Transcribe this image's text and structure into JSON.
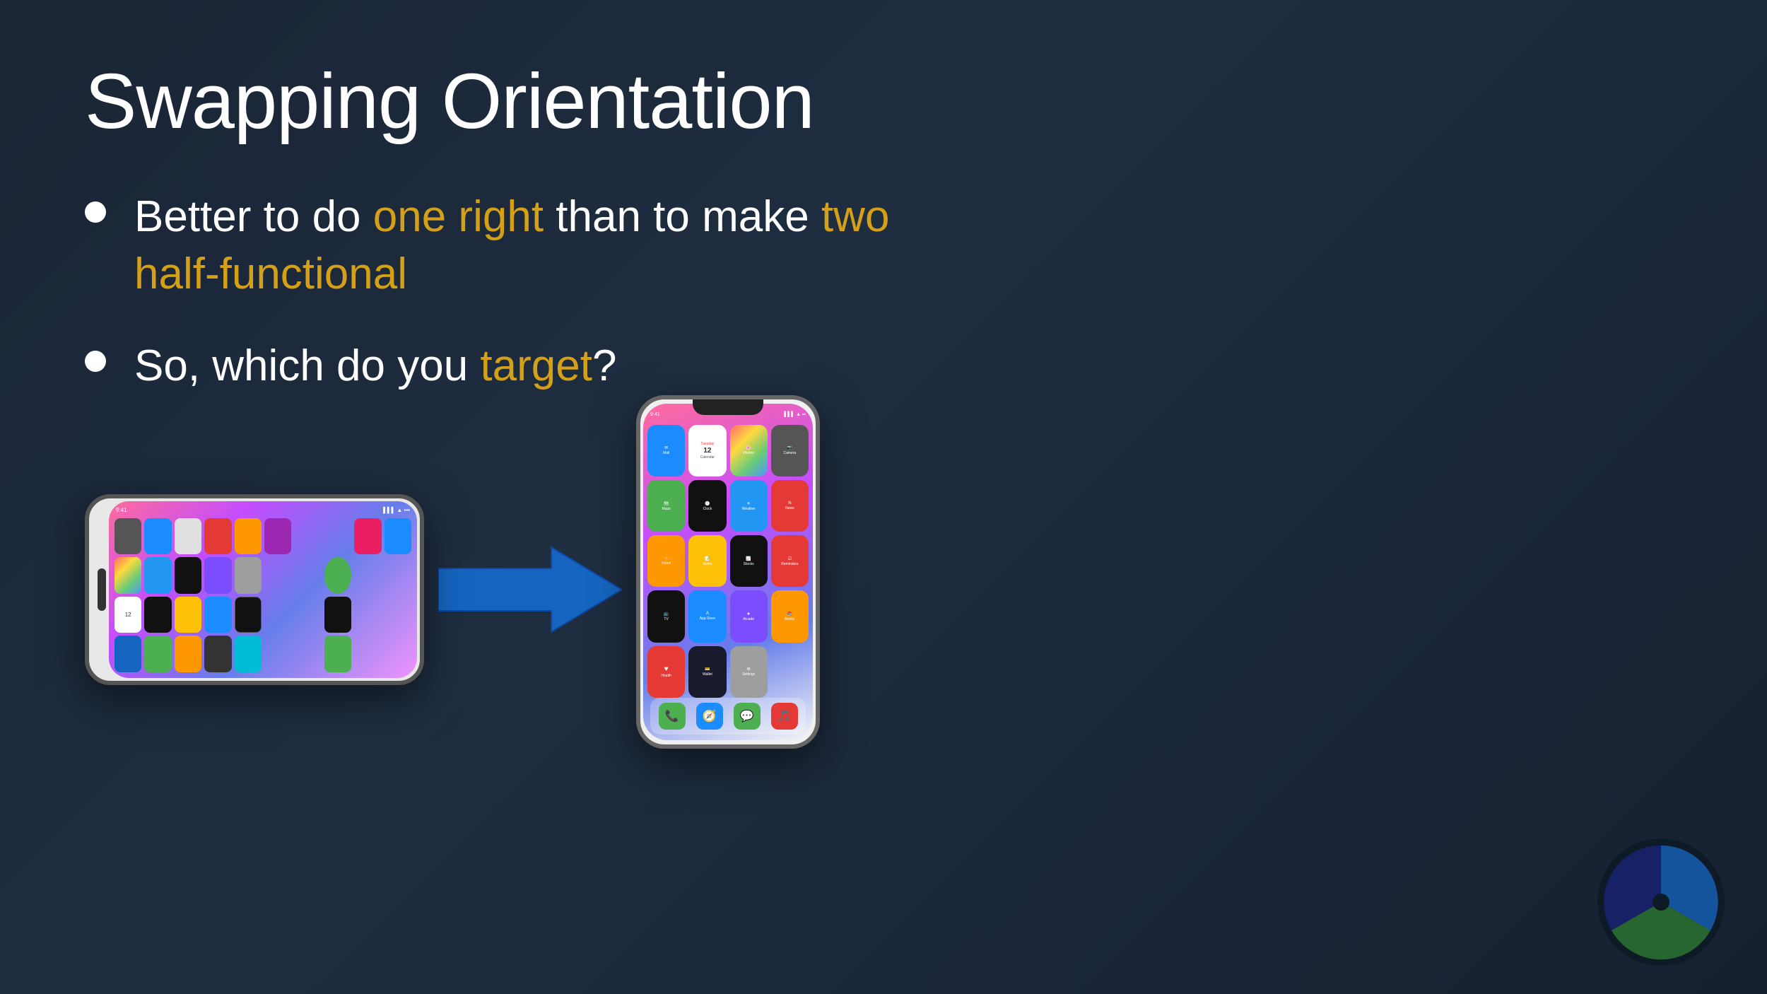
{
  "slide": {
    "title": "Swapping Orientation",
    "bullets": [
      {
        "id": "bullet1",
        "prefix": "Better to do ",
        "highlight1": "one right",
        "middle": " than to make ",
        "highlight2": "two half-functional",
        "suffix": ""
      },
      {
        "id": "bullet2",
        "prefix": "So, which do you ",
        "highlight": "target",
        "suffix": "?"
      }
    ],
    "arrow_label": "→",
    "phone_landscape": {
      "time": "9:41",
      "description": "iPhone in landscape orientation"
    },
    "phone_portrait": {
      "time": "9:41",
      "description": "iPhone in portrait orientation",
      "apps": [
        {
          "name": "Mail",
          "color": "app-mail"
        },
        {
          "name": "Calendar",
          "color": "app-calendar"
        },
        {
          "name": "Photos",
          "color": "app-photos"
        },
        {
          "name": "Camera",
          "color": "app-camera"
        },
        {
          "name": "Maps",
          "color": "app-maps"
        },
        {
          "name": "Clock",
          "color": "app-clock"
        },
        {
          "name": "Weather",
          "color": "app-weather"
        },
        {
          "name": "News",
          "color": "app-news"
        },
        {
          "name": "Home",
          "color": "app-home"
        },
        {
          "name": "Notes",
          "color": "app-notes"
        },
        {
          "name": "Stocks",
          "color": "app-stocks"
        },
        {
          "name": "Reminders",
          "color": "app-reminders"
        },
        {
          "name": "TV",
          "color": "app-tv"
        },
        {
          "name": "App Store",
          "color": "app-appstore"
        },
        {
          "name": "Arcade",
          "color": "app-arcade"
        },
        {
          "name": "Books",
          "color": "app-books"
        },
        {
          "name": "Health",
          "color": "app-health"
        },
        {
          "name": "Wallet",
          "color": "app-wallet"
        },
        {
          "name": "Settings",
          "color": "app-settings"
        }
      ],
      "dock": [
        {
          "name": "Phone",
          "color": "app-phone"
        },
        {
          "name": "Safari",
          "color": "app-safari"
        },
        {
          "name": "Messages",
          "color": "app-messages"
        },
        {
          "name": "Music",
          "color": "app-music"
        }
      ]
    }
  },
  "colors": {
    "title": "#ffffff",
    "bullet_text": "#ffffff",
    "highlight_yellow": "#d4a017",
    "highlight_gold": "#d4a017",
    "arrow_fill": "#1565c0",
    "arrow_stroke": "#0d47a1",
    "background_start": "#1a2535",
    "background_end": "#162030"
  }
}
